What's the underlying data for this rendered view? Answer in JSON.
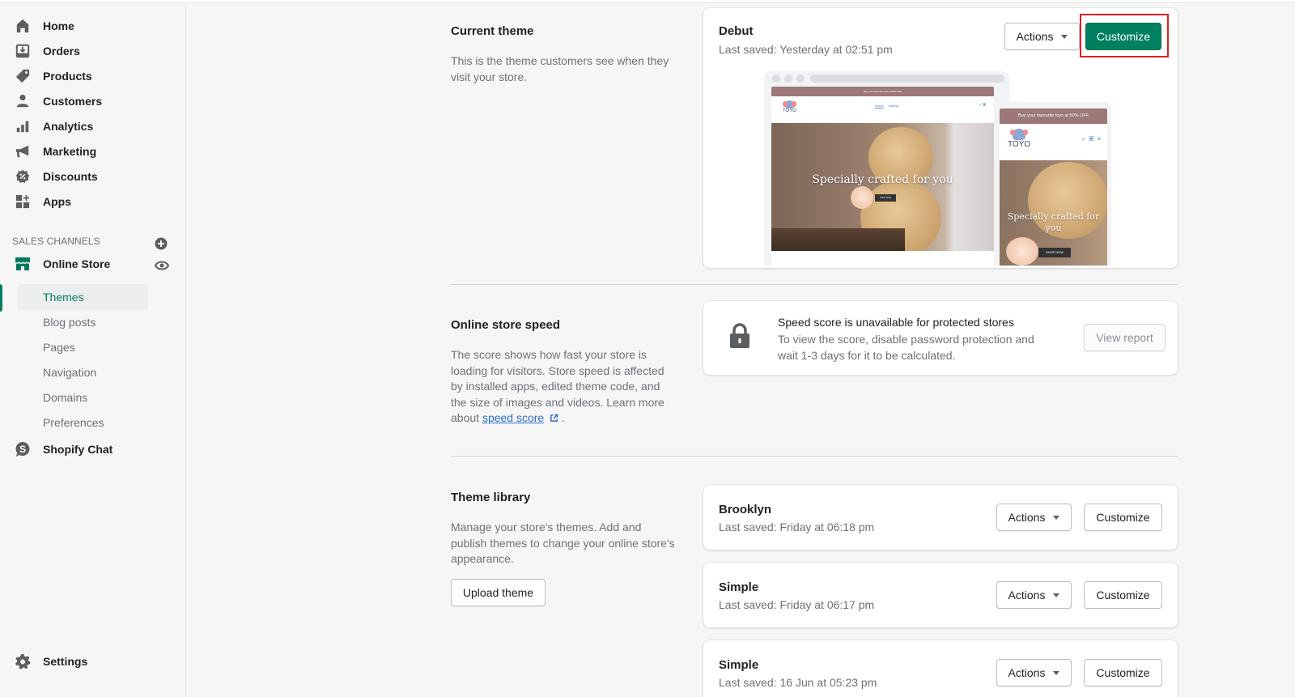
{
  "sidebar": {
    "nav": [
      {
        "label": "Home",
        "icon": "home-icon"
      },
      {
        "label": "Orders",
        "icon": "orders-icon"
      },
      {
        "label": "Products",
        "icon": "tag-icon"
      },
      {
        "label": "Customers",
        "icon": "person-icon"
      },
      {
        "label": "Analytics",
        "icon": "bar-chart-icon"
      },
      {
        "label": "Marketing",
        "icon": "megaphone-icon"
      },
      {
        "label": "Discounts",
        "icon": "discount-icon"
      },
      {
        "label": "Apps",
        "icon": "apps-icon"
      }
    ],
    "sales_channels": {
      "heading": "SALES CHANNELS",
      "online_store": {
        "label": "Online Store",
        "sub_items": [
          {
            "label": "Themes",
            "active": true
          },
          {
            "label": "Blog posts"
          },
          {
            "label": "Pages"
          },
          {
            "label": "Navigation"
          },
          {
            "label": "Domains"
          },
          {
            "label": "Preferences"
          }
        ]
      },
      "shopify_chat": {
        "label": "Shopify Chat"
      }
    },
    "settings": {
      "label": "Settings"
    }
  },
  "current_theme": {
    "title": "Current theme",
    "description": "This is the theme customers see when they visit your store.",
    "theme": {
      "name": "Debut",
      "last_saved": "Last saved: Yesterday at 02:51 pm",
      "actions_label": "Actions",
      "customize_label": "Customize"
    },
    "preview": {
      "desktop_announcement": "Buy your favourite toys at 50% OFF",
      "desktop_nav": [
        "Home",
        "Catalog"
      ],
      "logo_text": "TOYO",
      "hero_text": "Specially crafted for you",
      "desktop_cta": "SHOP NOW",
      "mobile_announcement": "Buy your favourite toys at 50% OFF",
      "mobile_cta": "SHOP NOW"
    }
  },
  "store_speed": {
    "title": "Online store speed",
    "description": "The score shows how fast your store is loading for visitors. Store speed is affected by installed apps, edited theme code, and the size of images and videos. Learn more about ",
    "link_text": "speed score",
    "description_end": " .",
    "card": {
      "heading": "Speed score is unavailable for protected stores",
      "body": "To view the score, disable password protection and wait 1-3 days for it to be calculated.",
      "button": "View report"
    }
  },
  "theme_library": {
    "title": "Theme library",
    "description": "Manage your store's themes. Add and publish themes to change your online store's appearance.",
    "upload_label": "Upload theme",
    "themes": [
      {
        "name": "Brooklyn",
        "last_saved": "Last saved: Friday at 06:18 pm",
        "actions_label": "Actions",
        "customize_label": "Customize"
      },
      {
        "name": "Simple",
        "last_saved": "Last saved: Friday at 06:17 pm",
        "actions_label": "Actions",
        "customize_label": "Customize"
      },
      {
        "name": "Simple",
        "last_saved": "Last saved: 16 Jun at 05:23 pm",
        "actions_label": "Actions",
        "customize_label": "Customize"
      }
    ]
  },
  "colors": {
    "primary": "#008060",
    "highlight": "#e0201f",
    "link": "#2c6ecb"
  }
}
